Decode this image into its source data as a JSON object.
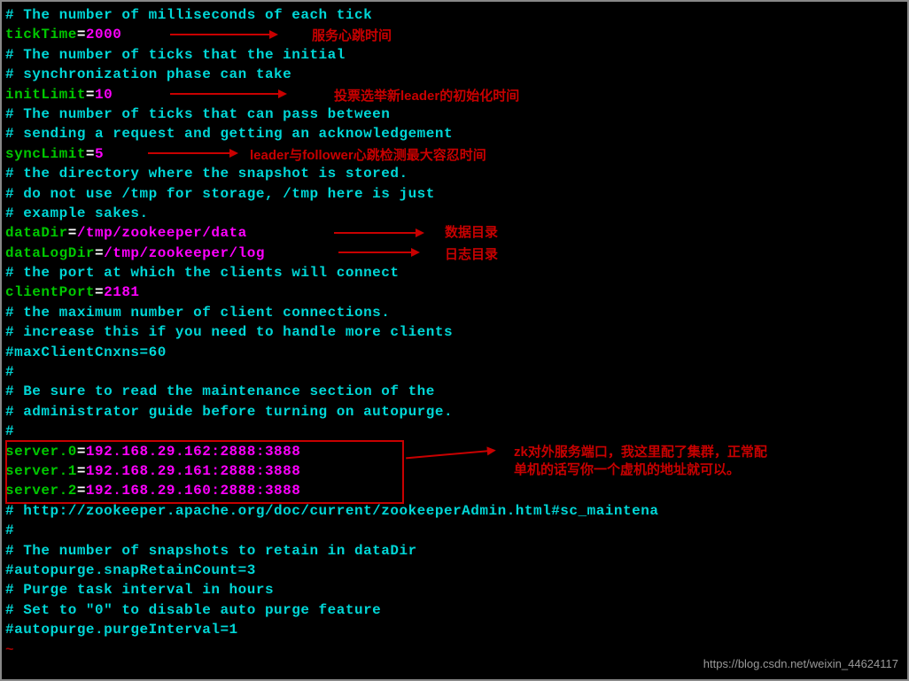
{
  "config": {
    "comment1": "# The number of milliseconds of each tick",
    "tickTime_key": "tickTime",
    "tickTime_val": "2000",
    "comment2": "# The number of ticks that the initial",
    "comment3": "# synchronization phase can take",
    "initLimit_key": "initLimit",
    "initLimit_val": "10",
    "comment4": "# The number of ticks that can pass between",
    "comment5": "# sending a request and getting an acknowledgement",
    "syncLimit_key": "syncLimit",
    "syncLimit_val": "5",
    "comment6": "# the directory where the snapshot is stored.",
    "comment7": "# do not use /tmp for storage, /tmp here is just",
    "comment8": "# example sakes.",
    "dataDir_key": "dataDir",
    "dataDir_val": "/tmp/zookeeper/data",
    "dataLogDir_key": "dataLogDir",
    "dataLogDir_val": "/tmp/zookeeper/log",
    "comment9": "# the port at which the clients will connect",
    "clientPort_key": "clientPort",
    "clientPort_val": "2181",
    "comment10": "# the maximum number of client connections.",
    "comment11": "# increase this if you need to handle more clients",
    "comment12": "#maxClientCnxns=60",
    "comment13": "#",
    "comment14": "# Be sure to read the maintenance section of the",
    "comment15": "# administrator guide before turning on autopurge.",
    "comment16": "#",
    "server0_key": "server.0",
    "server0_val": "192.168.29.162:2888:3888",
    "server1_key": "server.1",
    "server1_val": "192.168.29.161:2888:3888",
    "server2_key": "server.2",
    "server2_val": "192.168.29.160:2888:3888",
    "comment17": "# http://zookeeper.apache.org/doc/current/zookeeperAdmin.html#sc_maintena",
    "comment18": "#",
    "comment19": "# The number of snapshots to retain in dataDir",
    "comment20": "#autopurge.snapRetainCount=3",
    "comment21": "# Purge task interval in hours",
    "comment22": "# Set to \"0\" to disable auto purge feature",
    "comment23": "#autopurge.purgeInterval=1",
    "tilde": "~"
  },
  "annotations": {
    "tickTime": "服务心跳时间",
    "initLimit": "投票选举新leader的初始化时间",
    "syncLimit": "leader与follower心跳检测最大容忍时间",
    "dataDir": "数据目录",
    "dataLogDir": "日志目录",
    "servers1": "zk对外服务端口，我这里配了集群，正常配",
    "servers2": "单机的话写你一个虚机的地址就可以。"
  },
  "eq": "=",
  "watermark": "https://blog.csdn.net/weixin_44624117"
}
